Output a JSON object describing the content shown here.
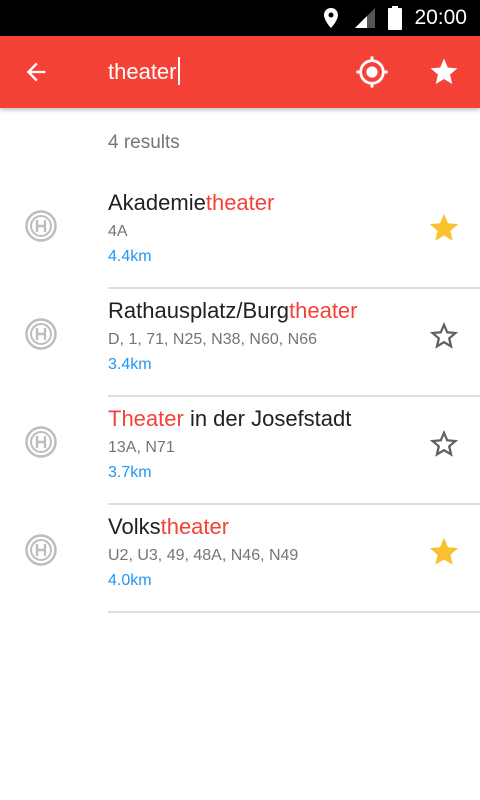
{
  "status_bar": {
    "time": "20:00",
    "icons": [
      "location-pin-icon",
      "signal-icon",
      "battery-icon"
    ]
  },
  "app_bar": {
    "back_icon": "arrow-left-icon",
    "search_query": "theater",
    "locate_icon": "my-location-icon",
    "favorites_icon": "star-icon",
    "background_color": "#f44336"
  },
  "results": {
    "count_label": "4 results",
    "items": [
      {
        "name_parts": [
          {
            "text": "Akademie",
            "hl": false
          },
          {
            "text": "theater",
            "hl": true
          }
        ],
        "lines": "4A",
        "distance": "4.4km",
        "favorite": true
      },
      {
        "name_parts": [
          {
            "text": "Rathausplatz/Burg",
            "hl": false
          },
          {
            "text": "theater",
            "hl": true
          }
        ],
        "lines": "D, 1, 71, N25, N38, N60, N66",
        "distance": "3.4km",
        "favorite": false
      },
      {
        "name_parts": [
          {
            "text": "Theater",
            "hl": true
          },
          {
            "text": " in der Josefstadt",
            "hl": false
          }
        ],
        "lines": "13A, N71",
        "distance": "3.7km",
        "favorite": false
      },
      {
        "name_parts": [
          {
            "text": "Volks",
            "hl": false
          },
          {
            "text": "theater",
            "hl": true
          }
        ],
        "lines": "U2, U3, 49, 48A, N46, N49",
        "distance": "4.0km",
        "favorite": true
      }
    ]
  },
  "colors": {
    "highlight": "#f44336",
    "distance": "#2196f3",
    "star_filled": "#fbc02d",
    "star_outline": "#616161"
  }
}
